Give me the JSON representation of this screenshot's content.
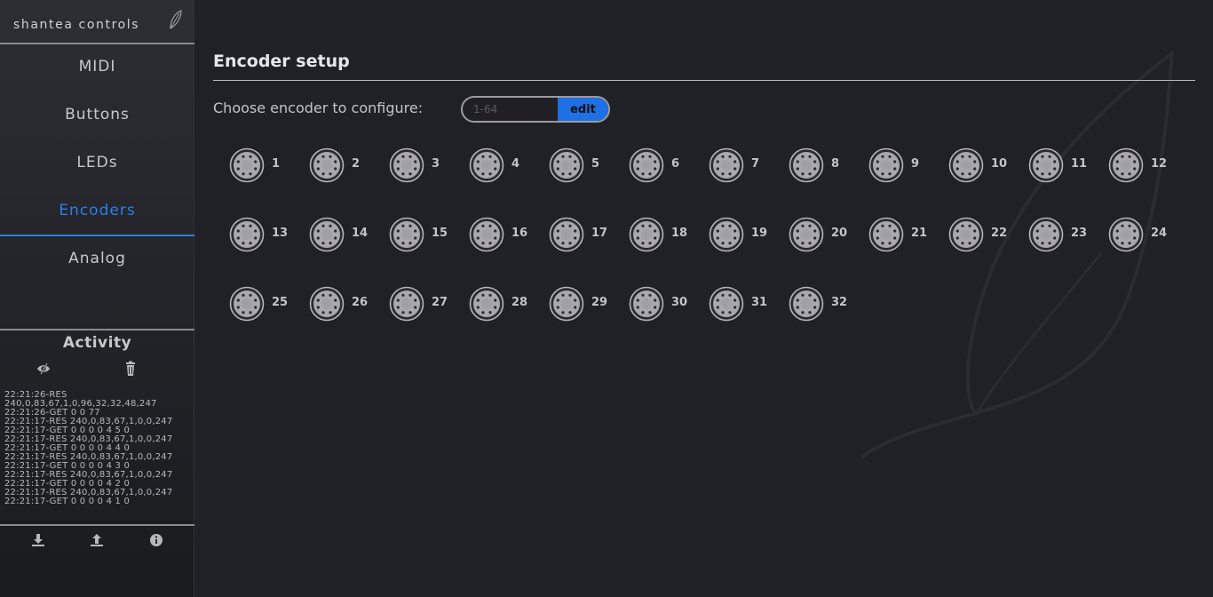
{
  "sidebar": {
    "logo": "shantea controls",
    "nav": [
      {
        "label": "MIDI"
      },
      {
        "label": "Buttons"
      },
      {
        "label": "LEDs"
      },
      {
        "label": "Encoders"
      },
      {
        "label": "Analog"
      }
    ],
    "active_nav": "Encoders",
    "activity": {
      "title": "Activity",
      "log": [
        "22:21:26-RES",
        "240,0,83,67,1,0,96,32,32,48,247",
        "22:21:26-GET 0 0 77",
        "22:21:17-RES 240,0,83,67,1,0,0,247",
        "22:21:17-GET 0 0 0 0 4 5 0",
        "22:21:17-RES 240,0,83,67,1,0,0,247",
        "22:21:17-GET 0 0 0 0 4 4 0",
        "22:21:17-RES 240,0,83,67,1,0,0,247",
        "22:21:17-GET 0 0 0 0 4 3 0",
        "22:21:17-RES 240,0,83,67,1,0,0,247",
        "22:21:17-GET 0 0 0 0 4 2 0",
        "22:21:17-RES 240,0,83,67,1,0,0,247",
        "22:21:17-GET 0 0 0 0 4 1 0"
      ]
    }
  },
  "main": {
    "title": "Encoder setup",
    "choose_label": "Choose encoder to configure:",
    "encoder_input_placeholder": "1-64",
    "edit_label": "edit",
    "encoders": [
      "1",
      "2",
      "3",
      "4",
      "5",
      "6",
      "7",
      "8",
      "9",
      "10",
      "11",
      "12",
      "13",
      "14",
      "15",
      "16",
      "17",
      "18",
      "19",
      "20",
      "21",
      "22",
      "23",
      "24",
      "25",
      "26",
      "27",
      "28",
      "29",
      "30",
      "31",
      "32"
    ]
  },
  "colors": {
    "accent": "#2f7dea",
    "background": "#202027",
    "sidebar": "#26282d"
  }
}
